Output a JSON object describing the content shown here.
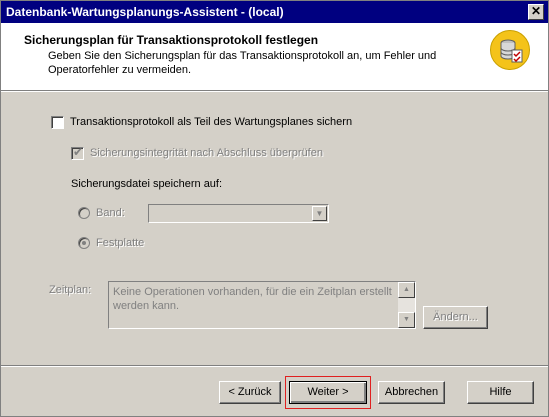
{
  "window": {
    "title": "Datenbank-Wartungsplanungs-Assistent - (local)",
    "close_label": "✕"
  },
  "header": {
    "title": "Sicherungsplan für Transaktionsprotokoll festlegen",
    "description": "Geben Sie den Sicherungsplan für das Transaktionsprotokoll an, um Fehler und Operatorfehler zu vermeiden.",
    "icon": "database-backup-icon"
  },
  "options": {
    "backup_log_label": "Transaktionsprotokoll als Teil des Wartungsplanes sichern",
    "backup_log_checked": false,
    "verify_label": "Sicherungsintegrität nach Abschluss überprüfen",
    "verify_checked": true,
    "save_to_label": "Sicherungsdatei speichern auf:",
    "tape_label": "Band:",
    "tape_value": "",
    "disk_label": "Festplatte",
    "selected_destination": "Festplatte"
  },
  "schedule": {
    "label": "Zeitplan:",
    "text": "Keine Operationen vorhanden, für die ein Zeitplan erstellt werden kann.",
    "change_label": "Ändern..."
  },
  "footer": {
    "back_label": "< Zurück",
    "next_label": "Weiter >",
    "cancel_label": "Abbrechen",
    "help_label": "Hilfe"
  },
  "colors": {
    "titlebar": "#000080",
    "dialog": "#d4d0c8",
    "highlight": "#e02020",
    "icon_background": "#f4c31a"
  }
}
